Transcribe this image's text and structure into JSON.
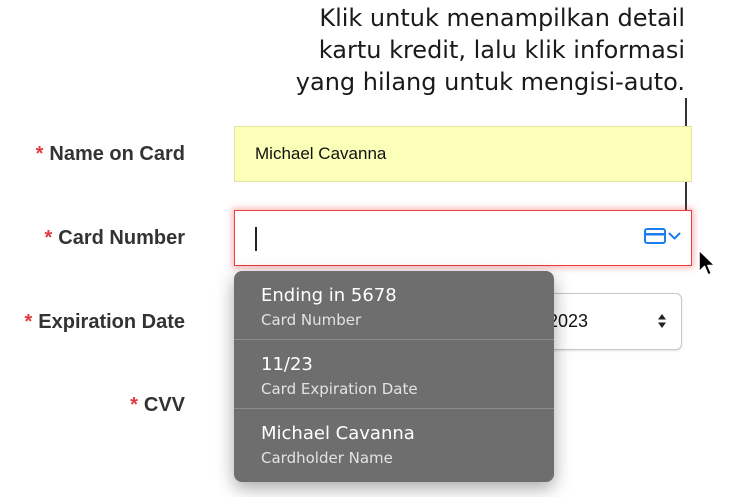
{
  "callout": {
    "line1": "Klik untuk menampilkan detail",
    "line2": "kartu kredit, lalu klik informasi",
    "line3": "yang hilang untuk mengisi-auto."
  },
  "form": {
    "required_marker": "*",
    "name_label": "Name on Card",
    "name_value": "Michael Cavanna",
    "card_number_label": "Card Number",
    "card_number_value": "",
    "expiration_label": "Expiration Date",
    "expiration_year": "2023",
    "cvv_label": "CVV"
  },
  "autofill_menu": {
    "items": [
      {
        "title": "Ending in 5678",
        "subtitle": "Card Number"
      },
      {
        "title": "11/23",
        "subtitle": "Card Expiration Date"
      },
      {
        "title": "Michael Cavanna",
        "subtitle": "Cardholder Name"
      }
    ]
  },
  "icons": {
    "card_autofill": "credit-card-icon",
    "chevron": "chevron-down-icon",
    "select_arrows": "up-down-arrows-icon",
    "pointer": "mouse-pointer-icon"
  },
  "colors": {
    "required": "#e0393e",
    "autofilled_bg": "#fbffb7",
    "error_border": "#ef3b3b",
    "accent_blue": "#1c7cf2",
    "menu_bg": "#6e6e6e"
  }
}
